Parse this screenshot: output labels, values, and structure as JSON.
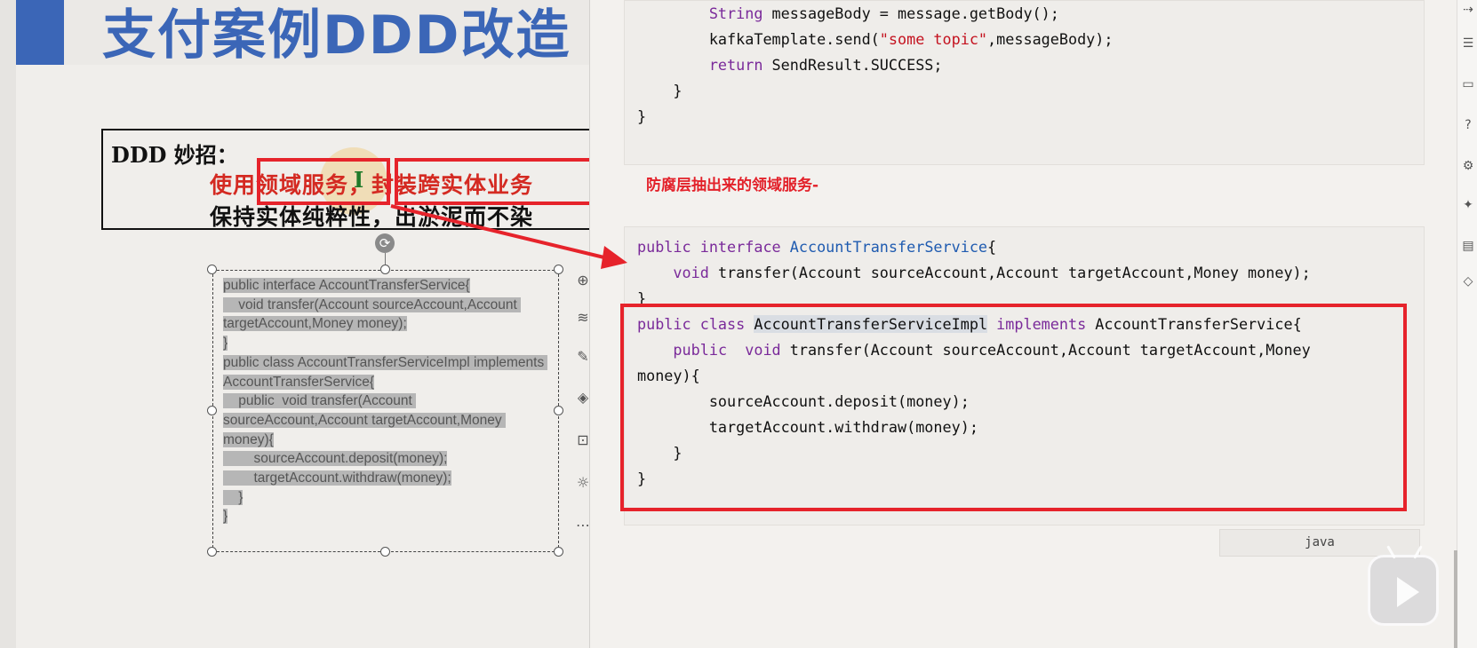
{
  "slide": {
    "title": "支付案例DDD改造",
    "tip_heading": "DDD 妙招：",
    "tip_line1": "使用领域服务，封装跨实体业务",
    "tip_line2": "保持实体纯粹性，出淤泥而不染",
    "selected_text": [
      "public interface AccountTransferService{",
      "    void transfer(Account sourceAccount,Account targetAccount,Money money);",
      "}",
      "public class AccountTransferServiceImpl implements AccountTransferService{",
      "    public  void transfer(Account sourceAccount,Account targetAccount,Money money){",
      "        sourceAccount.deposit(money);",
      "        targetAccount.withdraw(money);",
      "    }",
      "}"
    ]
  },
  "panel": {
    "code_block_1": {
      "line1_indent": "        ",
      "line1_type": "String",
      "line1_rest": " messageBody = message.getBody();",
      "line2_pre": "        kafkaTemplate.send(",
      "line2_str": "\"some topic\"",
      "line2_post": ",messageBody);",
      "line3_kw": "return",
      "line3_rest": " SendResult.SUCCESS;",
      "line4": "    }",
      "line5": "}"
    },
    "annotation": "防腐层抽出来的领域服务-",
    "code_block_2": {
      "l1_kw": "public interface",
      "l1_name": "AccountTransferService",
      "l1_end": "{",
      "l2_kw": "void",
      "l2_rest": " transfer(Account sourceAccount,Account targetAccount,Money money);",
      "l3": "}",
      "l4_kw": "public class",
      "l4_name": "AccountTransferServiceImpl",
      "l4_kw2": "implements",
      "l4_rest": " AccountTransferService{",
      "l5_kw": "public  void",
      "l5_rest": " transfer(Account sourceAccount,Account targetAccount,Money",
      "l6": "money){",
      "l7": "        sourceAccount.deposit(money);",
      "l8": "        targetAccount.withdraw(money);",
      "l9": "    }",
      "l10": "}"
    },
    "language_label": "java"
  },
  "colors": {
    "title_blue": "#3b66b7",
    "highlight_red": "#e6232b",
    "keyword_purple": "#7a2a9a",
    "type_blue": "#1f5bb0",
    "string_red": "#c4121f"
  },
  "icons": {
    "edge_toolbar": [
      "share-icon",
      "list-icon",
      "help-icon",
      "tools-icon",
      "bulb-icon",
      "book-icon",
      "stack-icon"
    ],
    "mini_toolbar": [
      "plus-icon",
      "layers-icon",
      "pen-icon",
      "fill-icon",
      "crop-icon",
      "idea-icon",
      "more-icon"
    ],
    "overlay": "play-icon"
  }
}
